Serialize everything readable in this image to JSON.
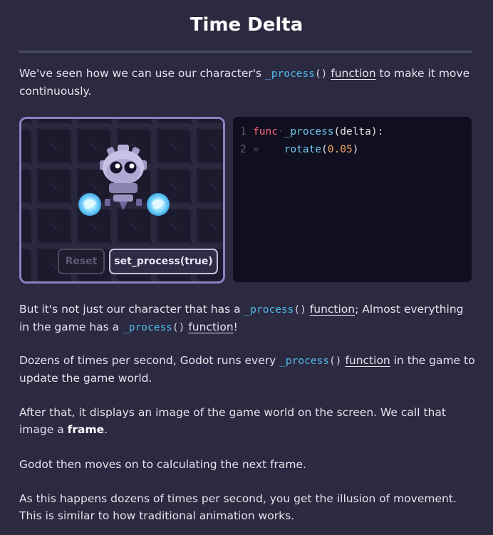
{
  "header": {
    "title": "Time Delta"
  },
  "intro": {
    "before": "We've seen how we can use our character's ",
    "code": "_process",
    "parens": "()",
    "link": "function",
    "after": " to make it move continuously."
  },
  "demo": {
    "reset_label": "Reset",
    "process_label": "set_process(true)",
    "colors": {
      "frame_border": "#8b83c2",
      "background": "#1b1a2c"
    }
  },
  "editor": {
    "lines": [
      {
        "number": "1",
        "keyword": "func",
        "space_marker": "·",
        "name": "_process",
        "args": "(delta):"
      },
      {
        "number": "2",
        "tab_marker": "»",
        "call": "rotate",
        "open": "(",
        "value": "0.05",
        "close": ")"
      }
    ]
  },
  "paragraphs": {
    "p1": {
      "a": "But it's not just our character that has a ",
      "code1": "_process",
      "parens1": "()",
      "link1": "function",
      "b": "; Almost everything in the game has a ",
      "code2": "_process",
      "parens2": "()",
      "link2": "function",
      "c": "!"
    },
    "p2": {
      "a": "Dozens of times per second, Godot runs every ",
      "code": "_process",
      "parens": "()",
      "link": "function",
      "b": " in the game to update the game world."
    },
    "p3": {
      "a": "After that, it displays an image of the game world on the screen. We call that image a ",
      "bold": "frame",
      "b": "."
    },
    "p4": "Godot then moves on to calculating the next frame.",
    "p5": "As this happens dozens of times per second, you get the illusion of movement. This is similar to how traditional animation works."
  }
}
